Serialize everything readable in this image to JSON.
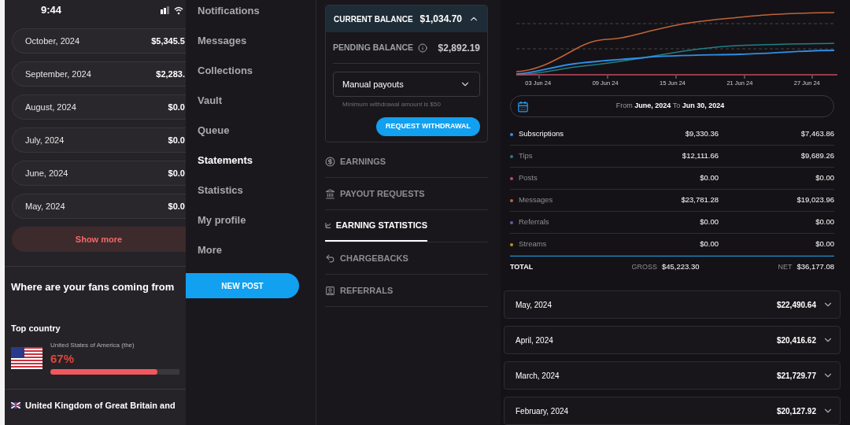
{
  "phone": {
    "time": "9:44",
    "months": [
      {
        "label": "October, 2024",
        "amount": "$5,345.5"
      },
      {
        "label": "September, 2024",
        "amount": "$2,283."
      },
      {
        "label": "August, 2024",
        "amount": "$0.0"
      },
      {
        "label": "July, 2024",
        "amount": "$0.0"
      },
      {
        "label": "June, 2024",
        "amount": "$0.0"
      },
      {
        "label": "May, 2024",
        "amount": "$0.0"
      }
    ],
    "show_more": "Show more",
    "fans_title": "Where are your fans coming from",
    "top_country_label": "Top country",
    "top_country": {
      "name": "United States of America (the)",
      "percent": "67%",
      "level": 0.83
    },
    "next_country": "United Kingdom of Great Britain and"
  },
  "sidebar": {
    "items": [
      {
        "label": "Notifications",
        "selected": false
      },
      {
        "label": "Messages",
        "selected": false
      },
      {
        "label": "Collections",
        "selected": false
      },
      {
        "label": "Vault",
        "selected": false
      },
      {
        "label": "Queue",
        "selected": false
      },
      {
        "label": "Statements",
        "selected": true
      },
      {
        "label": "Statistics",
        "selected": false
      },
      {
        "label": "My profile",
        "selected": false
      },
      {
        "label": "More",
        "selected": false
      }
    ],
    "new_post": "NEW POST"
  },
  "balance": {
    "current_label": "CURRENT BALANCE",
    "current": "$1,034.70",
    "expanded": true,
    "pending_label": "PENDING BALANCE",
    "pending": "$2,892.19",
    "payout_mode": "Manual payouts",
    "hint": "Minimum withdrawal amount is $50",
    "button": "REQUEST WITHDRAWAL"
  },
  "sections": [
    {
      "label": "EARNINGS",
      "selected": false
    },
    {
      "label": "PAYOUT REQUESTS",
      "selected": false
    },
    {
      "label": "EARNING STATISTICS",
      "selected": true
    },
    {
      "label": "CHARGEBACKS",
      "selected": false
    },
    {
      "label": "REFERRALS",
      "selected": false
    }
  ],
  "chart": {
    "x_labels": [
      "03 Jun 24",
      "09 Jun 24",
      "15 Jun 24",
      "21 Jun 24",
      "27 Jun 24"
    ]
  },
  "date_range": {
    "from_label": "From",
    "from": "June, 2024",
    "to_label": "To",
    "to": "Jun 30, 2024"
  },
  "earnings": [
    {
      "name": "Subscriptions",
      "color": "#2f8fe8",
      "gross": "$9,330.36",
      "net": "$7,463.86",
      "selected": true
    },
    {
      "name": "Tips",
      "color": "#1f8088",
      "gross": "$12,111.66",
      "net": "$9,689.26",
      "selected": false
    },
    {
      "name": "Posts",
      "color": "#c04a60",
      "gross": "$0.00",
      "net": "$0.00",
      "selected": false
    },
    {
      "name": "Messages",
      "color": "#c0643a",
      "gross": "$23,781.28",
      "net": "$19,023.96",
      "selected": false
    },
    {
      "name": "Referrals",
      "color": "#6a5c9a",
      "gross": "$0.00",
      "net": "$0.00",
      "selected": false
    },
    {
      "name": "Streams",
      "color": "#c08a2a",
      "gross": "$0.00",
      "net": "$0.00",
      "selected": false
    }
  ],
  "total": {
    "label": "TOTAL",
    "gross_label": "GROSS",
    "gross": "$45,223.30",
    "net_label": "NET",
    "net": "$36,177.08"
  },
  "monthly": [
    {
      "label": "May, 2024",
      "amount": "$22,490.64",
      "expanded": false
    },
    {
      "label": "April, 2024",
      "amount": "$20,416.62",
      "expanded": false
    },
    {
      "label": "March, 2024",
      "amount": "$21,729.77",
      "expanded": false
    },
    {
      "label": "February, 2024",
      "amount": "$20,127.92",
      "expanded": false
    }
  ]
}
